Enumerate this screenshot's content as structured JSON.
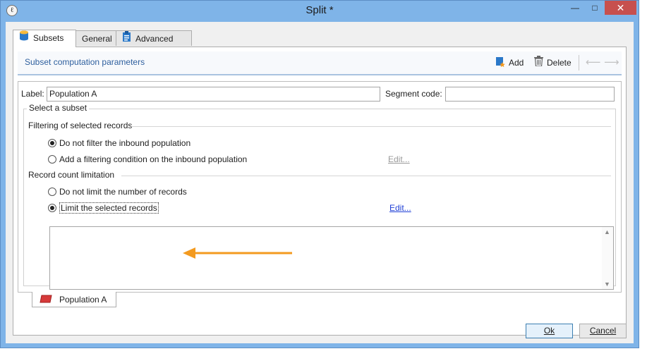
{
  "window": {
    "title": "Split *",
    "close_glyph": "✕",
    "minimize_glyph": "—",
    "maximize_glyph": "□"
  },
  "tabs": [
    {
      "label": "Subsets",
      "icon": "database-icon",
      "active": true
    },
    {
      "label": "General",
      "icon": "",
      "active": false
    },
    {
      "label": "Advanced",
      "icon": "clipboard-icon",
      "active": false
    }
  ],
  "section": {
    "title": "Subset computation parameters",
    "add_label": "Add",
    "delete_label": "Delete"
  },
  "form": {
    "label_caption": "Label:",
    "label_value": "Population A",
    "segment_caption": "Segment code:",
    "segment_value": "",
    "group_title": "Select a subset",
    "filtering_heading": "Filtering of selected records",
    "filter_option_1": "Do not filter the inbound population",
    "filter_option_2": "Add a filtering condition on the inbound population",
    "filter_edit": "Edit...",
    "limit_heading": "Record count limitation",
    "limit_option_1": "Do not limit the number of records",
    "limit_option_2": "Limit the selected records",
    "limit_edit": "Edit...",
    "memo_value": ""
  },
  "subset_tab": {
    "label": "Population A"
  },
  "buttons": {
    "ok": "Ok",
    "cancel": "Cancel"
  },
  "colors": {
    "window_frame": "#7fb4e8",
    "close_button": "#c7504e",
    "section_title": "#2e5f9e",
    "link": "#1f3fd6",
    "annotation_arrow": "#f39a1f"
  }
}
